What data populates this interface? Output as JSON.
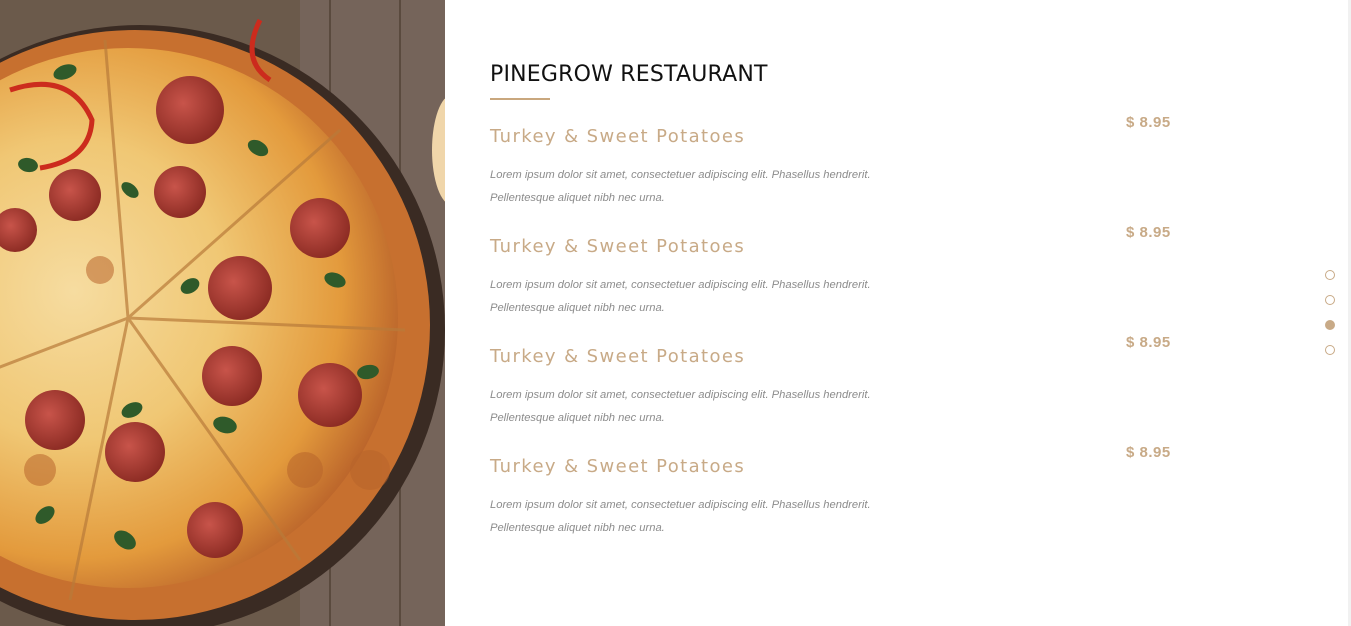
{
  "menu_section": {
    "title": "PINEGROW RESTAURANT",
    "items": [
      {
        "name": "Turkey & Sweet Potatoes",
        "price": "$ 8.95",
        "description_line1": "Lorem ipsum dolor sit amet, consectetuer adipiscing elit. Phasellus hendrerit.",
        "description_line2": "Pellentesque aliquet nibh nec urna."
      },
      {
        "name": "Turkey & Sweet Potatoes",
        "price": "$ 8.95",
        "description_line1": "Lorem ipsum dolor sit amet, consectetuer adipiscing elit. Phasellus hendrerit.",
        "description_line2": "Pellentesque aliquet nibh nec urna."
      },
      {
        "name": "Turkey & Sweet Potatoes",
        "price": "$ 8.95",
        "description_line1": "Lorem ipsum dolor sit amet, consectetuer adipiscing elit. Phasellus hendrerit.",
        "description_line2": "Pellentesque aliquet nibh nec urna."
      },
      {
        "name": "Turkey & Sweet Potatoes",
        "price": "$ 8.95",
        "description_line1": "Lorem ipsum dolor sit amet, consectetuer adipiscing elit. Phasellus hendrerit.",
        "description_line2": "Pellentesque aliquet nibh nec urna."
      }
    ]
  },
  "image": {
    "subject": "pepperoni-pizza-photo"
  },
  "pagination": {
    "dot_count": 4,
    "active_index": 2
  },
  "colors": {
    "accent": "#c8aa87",
    "title": "#111111",
    "description": "#8c8c8c",
    "background": "#ffffff"
  }
}
